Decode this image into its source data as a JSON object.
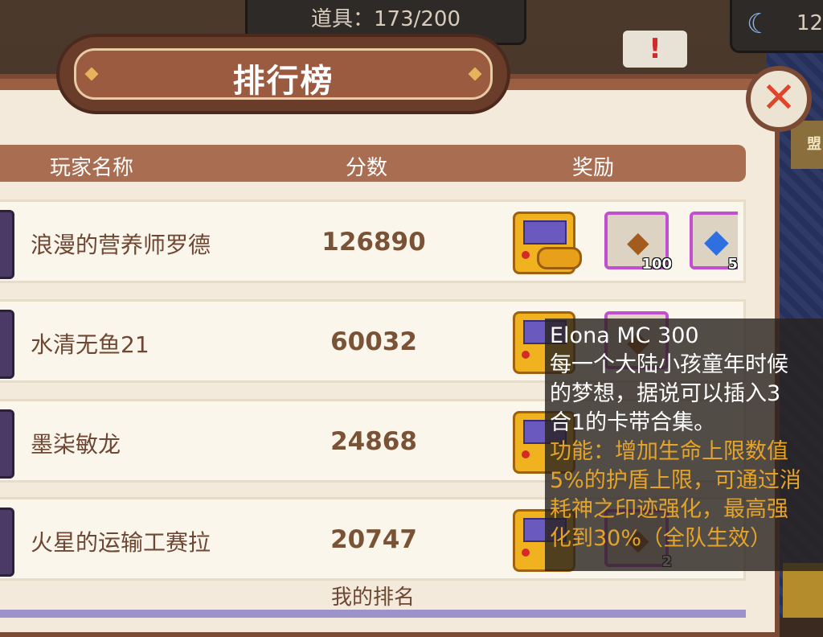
{
  "hud": {
    "item_counter": "道具：173/200",
    "moon_value": "12",
    "alert_symbol": "!"
  },
  "side_label": "盟",
  "panel": {
    "title": "排行榜",
    "close_symbol": "✕",
    "headers": {
      "name": "玩家名称",
      "score": "分数",
      "reward": "奖励"
    },
    "rows": [
      {
        "name": "浪漫的营养师罗德",
        "score": "126890",
        "reward_qty_1": "100",
        "reward_qty_2": "5"
      },
      {
        "name": "水清无鱼21",
        "score": "60032",
        "reward_qty_1": "",
        "reward_qty_2": ""
      },
      {
        "name": "墨柒敏龙",
        "score": "24868",
        "reward_qty_1": "",
        "reward_qty_2": ""
      },
      {
        "name": "火星的运输工赛拉",
        "score": "20747",
        "reward_qty_1": "2",
        "reward_qty_2": ""
      }
    ],
    "my_rank_label": "我的排名"
  },
  "tooltip": {
    "title": "Elona MC 300",
    "desc_lines": [
      "每一个大陆小孩童年时候",
      "的梦想，据说可以插入3",
      "合1的卡带合集。"
    ],
    "func_lines": [
      "功能：增加生命上限数值",
      "5%的护盾上限，可通过消",
      "耗神之印迹强化，最高强",
      "化到30%（全队生效）"
    ]
  },
  "colors": {
    "panel_border": "#7a4a34",
    "header_bg": "#a96d52",
    "tooltip_function_text": "#e4a32a",
    "close_x": "#e0442b"
  }
}
